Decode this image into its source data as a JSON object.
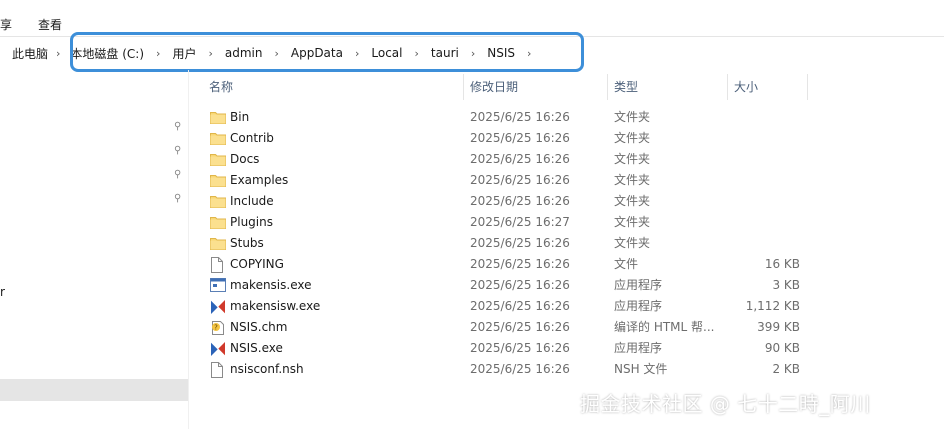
{
  "ribbon": {
    "tabs": [
      "享",
      "查看"
    ]
  },
  "address": {
    "crumbs": [
      "此电脑",
      "本地磁盘 (C:)",
      "用户",
      "admin",
      "AppData",
      "Local",
      "tauri",
      "NSIS"
    ]
  },
  "navpane": {
    "stray_text": "r"
  },
  "columns": {
    "name": "名称",
    "date": "修改日期",
    "type": "类型",
    "size": "大小"
  },
  "files": [
    {
      "name": "Bin",
      "date": "2025/6/25 16:26",
      "type": "文件夹",
      "size": "",
      "icon": "folder-icon"
    },
    {
      "name": "Contrib",
      "date": "2025/6/25 16:26",
      "type": "文件夹",
      "size": "",
      "icon": "folder-icon"
    },
    {
      "name": "Docs",
      "date": "2025/6/25 16:26",
      "type": "文件夹",
      "size": "",
      "icon": "folder-icon"
    },
    {
      "name": "Examples",
      "date": "2025/6/25 16:26",
      "type": "文件夹",
      "size": "",
      "icon": "folder-icon"
    },
    {
      "name": "Include",
      "date": "2025/6/25 16:26",
      "type": "文件夹",
      "size": "",
      "icon": "folder-icon"
    },
    {
      "name": "Plugins",
      "date": "2025/6/25 16:27",
      "type": "文件夹",
      "size": "",
      "icon": "folder-icon"
    },
    {
      "name": "Stubs",
      "date": "2025/6/25 16:26",
      "type": "文件夹",
      "size": "",
      "icon": "folder-icon"
    },
    {
      "name": "COPYING",
      "date": "2025/6/25 16:26",
      "type": "文件",
      "size": "16 KB",
      "icon": "file-icon"
    },
    {
      "name": "makensis.exe",
      "date": "2025/6/25 16:26",
      "type": "应用程序",
      "size": "3 KB",
      "icon": "console-app-icon"
    },
    {
      "name": "makensisw.exe",
      "date": "2025/6/25 16:26",
      "type": "应用程序",
      "size": "1,112 KB",
      "icon": "nsis-app-icon"
    },
    {
      "name": "NSIS.chm",
      "date": "2025/6/25 16:26",
      "type": "编译的 HTML 帮...",
      "size": "399 KB",
      "icon": "chm-help-icon"
    },
    {
      "name": "NSIS.exe",
      "date": "2025/6/25 16:26",
      "type": "应用程序",
      "size": "90 KB",
      "icon": "nsis-app-icon"
    },
    {
      "name": "nsisconf.nsh",
      "date": "2025/6/25 16:26",
      "type": "NSH 文件",
      "size": "2 KB",
      "icon": "file-icon"
    }
  ],
  "watermark": "掘金技术社区 @ 七十二時_阿川",
  "colors": {
    "highlight": "#3d8fd9",
    "folder": "#f8d775",
    "header_text": "#4c607a"
  }
}
